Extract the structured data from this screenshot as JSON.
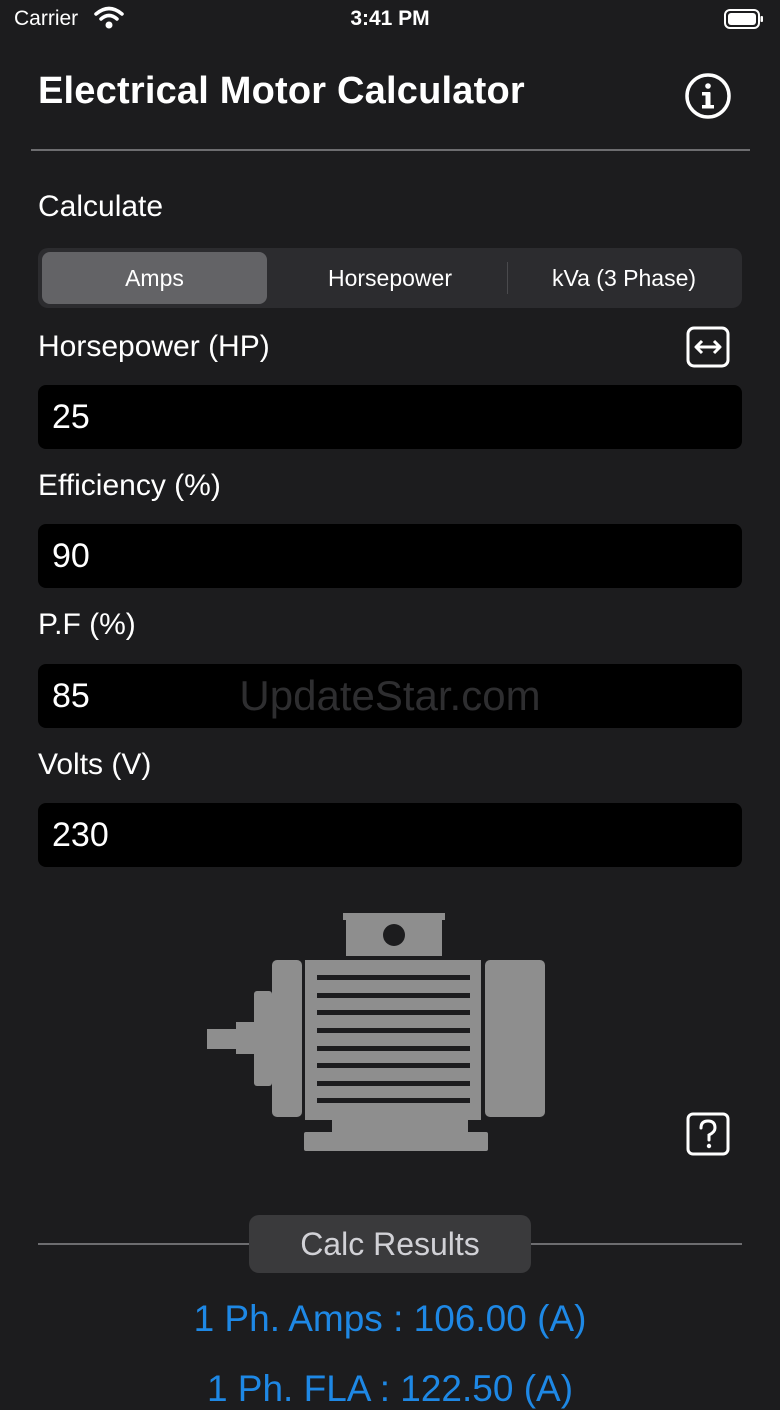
{
  "status_bar": {
    "carrier": "Carrier",
    "time": "3:41 PM"
  },
  "header": {
    "title": "Electrical Motor Calculator",
    "info_icon": "info-circle-icon"
  },
  "calculate": {
    "label": "Calculate",
    "segments": [
      "Amps",
      "Horsepower",
      "kVa (3 Phase)"
    ],
    "selected": "Amps"
  },
  "fields": [
    {
      "label": "Horsepower (HP)",
      "value": "25"
    },
    {
      "label": "Efficiency (%)",
      "value": "90"
    },
    {
      "label": "P.F (%)",
      "value": "85"
    },
    {
      "label": "Volts (V)",
      "value": "230"
    }
  ],
  "watermark": "UpdateStar.com",
  "results": {
    "button_label": "Calc Results",
    "lines": [
      "1 Ph. Amps : 106.00 (A)",
      "1 Ph. FLA : 122.50 (A)"
    ]
  },
  "colors": {
    "background": "#1c1c1e",
    "result_text": "#1e88e5",
    "input_bg": "#000000"
  }
}
